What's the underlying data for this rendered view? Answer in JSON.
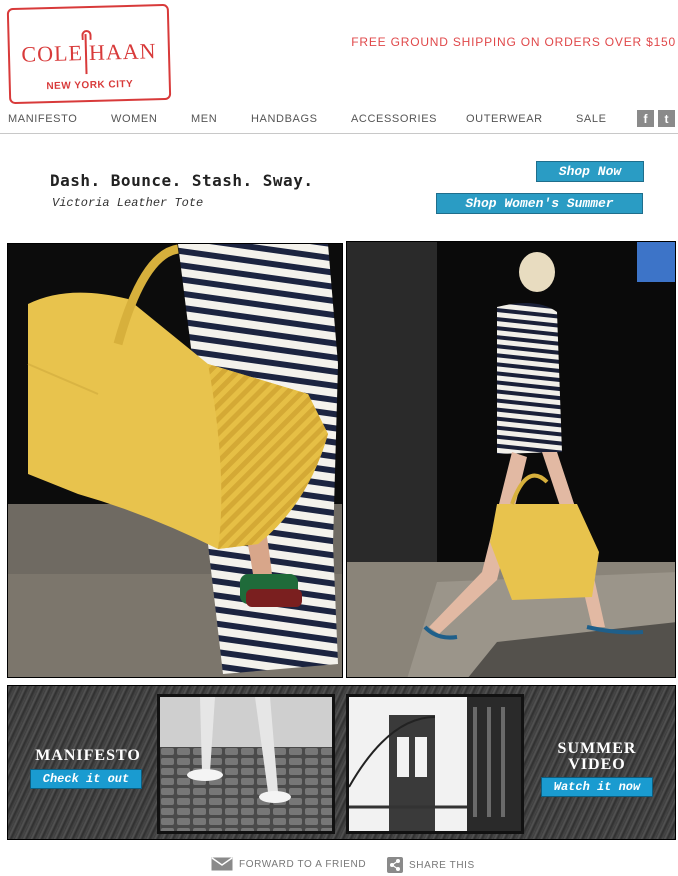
{
  "header": {
    "brand": "COLE HAAN",
    "brand_left": "COLE",
    "brand_right": "HAAN",
    "city": "NEW YORK CITY",
    "shipping_banner": "FREE GROUND SHIPPING ON ORDERS OVER $150"
  },
  "nav": {
    "items": [
      {
        "label": "MANIFESTO"
      },
      {
        "label": "WOMEN"
      },
      {
        "label": "MEN"
      },
      {
        "label": "HANDBAGS"
      },
      {
        "label": "ACCESSORIES"
      },
      {
        "label": "OUTERWEAR"
      },
      {
        "label": "SALE"
      }
    ],
    "social": [
      {
        "icon": "facebook-icon",
        "glyph": "f"
      },
      {
        "icon": "twitter-icon",
        "glyph": "t"
      }
    ]
  },
  "hero": {
    "headline": "Dash. Bounce. Stash. Sway.",
    "subline": "Victoria Leather Tote",
    "shop_now": "Shop Now",
    "shop_womens_summer": "Shop Women's Summer"
  },
  "strip": {
    "manifesto_title": "MANIFESTO",
    "manifesto_cta": "Check it out",
    "video_title_line1": "SUMMER",
    "video_title_line2": "VIDEO",
    "video_cta": "Watch it now"
  },
  "footer": {
    "forward": "FORWARD TO A FRIEND",
    "share": "SHARE THIS"
  },
  "colors": {
    "brand_red": "#d83a3a",
    "cta_blue": "#2a9cc4",
    "strip_cta_blue": "#1a9bd0",
    "tote_yellow": "#e8c34d"
  }
}
